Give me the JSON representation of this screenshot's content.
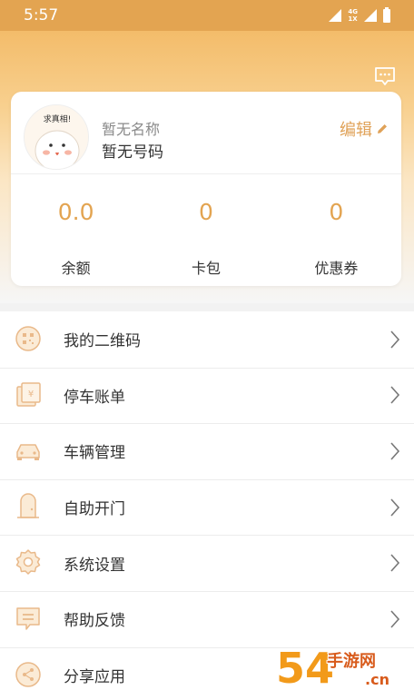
{
  "status_bar": {
    "time": "5:57",
    "network": "4G",
    "network_sub": "1X"
  },
  "profile": {
    "name": "暂无名称",
    "phone": "暂无号码",
    "edit_label": "编辑",
    "avatar_text": "求真相!"
  },
  "stats": [
    {
      "value": "0.0",
      "label": "余额"
    },
    {
      "value": "0",
      "label": "卡包"
    },
    {
      "value": "0",
      "label": "优惠券"
    }
  ],
  "menu": [
    {
      "label": "我的二维码",
      "icon": "qrcode-icon"
    },
    {
      "label": "停车账单",
      "icon": "bill-icon"
    },
    {
      "label": "车辆管理",
      "icon": "car-icon"
    },
    {
      "label": "自助开门",
      "icon": "door-icon"
    },
    {
      "label": "系统设置",
      "icon": "gear-icon"
    },
    {
      "label": "帮助反馈",
      "icon": "feedback-icon"
    },
    {
      "label": "分享应用",
      "icon": "share-icon"
    }
  ],
  "watermark": {
    "number": "54",
    "chars": "手游网",
    "domain": ".cn"
  },
  "colors": {
    "accent": "#e3a451",
    "icon": "#e9b98a",
    "text": "#333333",
    "muted": "#8a8a8a"
  }
}
